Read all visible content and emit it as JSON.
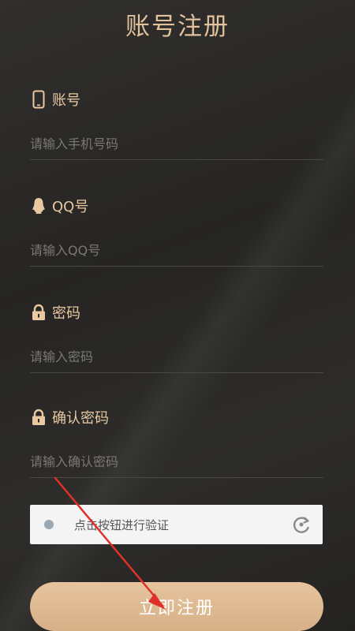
{
  "page": {
    "title": "账号注册"
  },
  "fields": [
    {
      "label": "账号",
      "placeholder": "请输入手机号码",
      "icon": "phone-icon"
    },
    {
      "label": "QQ号",
      "placeholder": "请输入QQ号",
      "icon": "qq-penguin-icon"
    },
    {
      "label": "密码",
      "placeholder": "请输入密码",
      "icon": "lock-icon"
    },
    {
      "label": "确认密码",
      "placeholder": "请输入确认密码",
      "icon": "lock-icon"
    }
  ],
  "captcha": {
    "text": "点击按钮进行验证",
    "icon": "refresh-icon"
  },
  "register_button": {
    "label": "立即注册"
  },
  "colors": {
    "accent": "#e2c09a",
    "button": "#ddb98f",
    "background": "#2b2a28",
    "arrow": "#e0302a"
  }
}
